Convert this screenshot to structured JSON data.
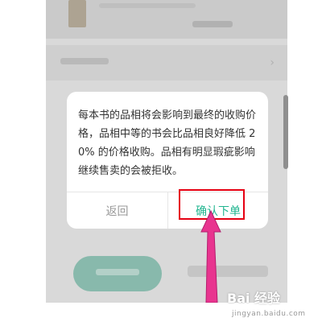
{
  "dialog": {
    "message": "每本书的品相将会影响到最终的收购价格，品相中等的书会比品相良好降低 20% 的价格收购。品相有明显瑕疵影响继续售卖的会被拒收。",
    "back_label": "返回",
    "confirm_label": "确认下单"
  },
  "colors": {
    "confirm": "#20b58f",
    "back": "#999999",
    "highlight": "#e60012",
    "arrow": "#e8348f"
  },
  "watermark": {
    "text": "Bai 经验",
    "sub": "jingyan.baidu.com"
  }
}
